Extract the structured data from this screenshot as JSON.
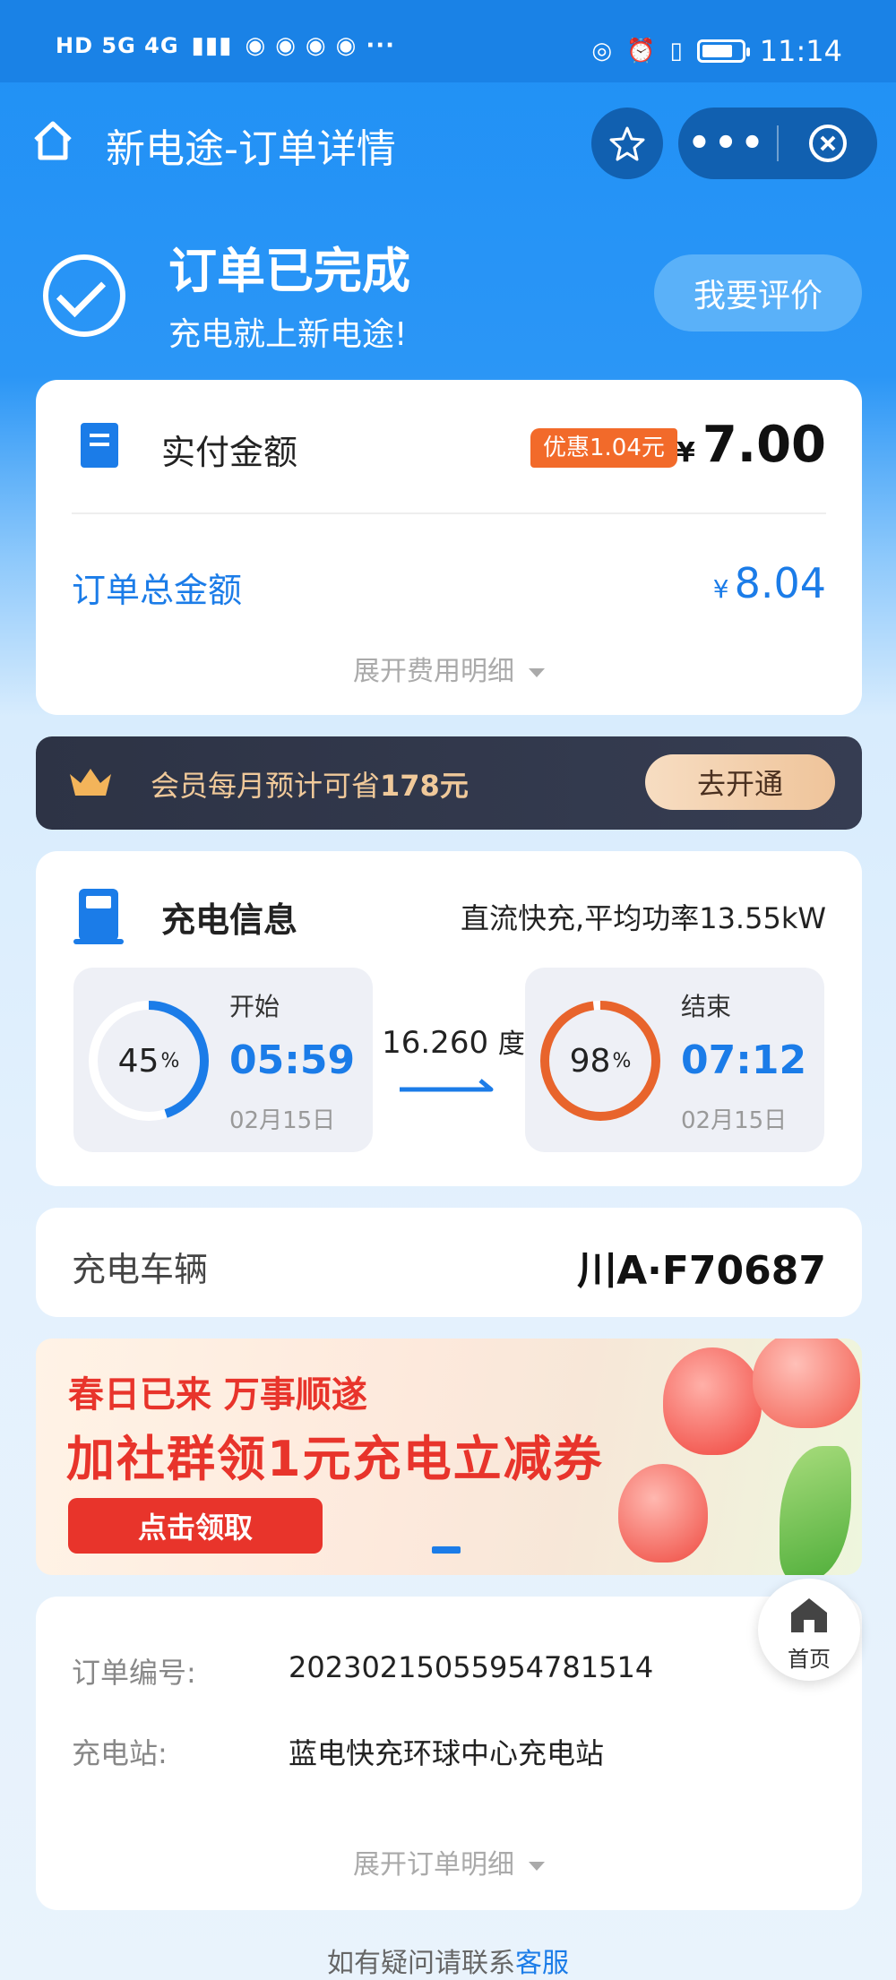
{
  "status_bar": {
    "left_indicators": "HD 5G 4G",
    "time": "11:14"
  },
  "nav": {
    "title": "新电途-订单详情"
  },
  "order_status": {
    "title": "订单已完成",
    "subtitle": "充电就上新电途!",
    "review_button": "我要评价"
  },
  "payment": {
    "label": "实付金额",
    "discount_badge": "优惠1.04元",
    "currency": "¥",
    "amount": "7.00",
    "total_label": "订单总金额",
    "total_amount": "8.04",
    "expand_label": "展开费用明细"
  },
  "member": {
    "text_prefix": "会员每月预计可省",
    "text_amount": "178元",
    "button": "去开通"
  },
  "charging": {
    "label": "充电信息",
    "type": "直流快充,平均功率13.55kW",
    "start": {
      "label": "开始",
      "soc": "45",
      "soc_value": 0.45,
      "time": "05:59",
      "date": "02月15日"
    },
    "end": {
      "label": "结束",
      "soc": "98",
      "soc_value": 0.98,
      "time": "07:12",
      "date": "02月15日"
    },
    "percent_sign": "%",
    "energy": "16.260",
    "energy_unit": "度"
  },
  "vehicle": {
    "label": "充电车辆",
    "plate": "川A·F70687"
  },
  "promo": {
    "line1": "春日已来 万事顺遂",
    "line2": "加社群领1元充电立减券",
    "button": "点击领取"
  },
  "order": {
    "number_label": "订单编号:",
    "number_value": "20230215055954781514",
    "station_label": "充电站:",
    "station_value": "蓝电快充环球中心充电站",
    "expand_label": "展开订单明细"
  },
  "fab": {
    "label": "首页"
  },
  "footer": {
    "text": "如有疑问请联系",
    "link": "客服"
  },
  "colors": {
    "primary": "#1b7ce8",
    "header_blue": "#1f90f5",
    "discount_orange": "#f26a2a",
    "end_ring": "#e8642c",
    "promo_red": "#e8342b"
  }
}
